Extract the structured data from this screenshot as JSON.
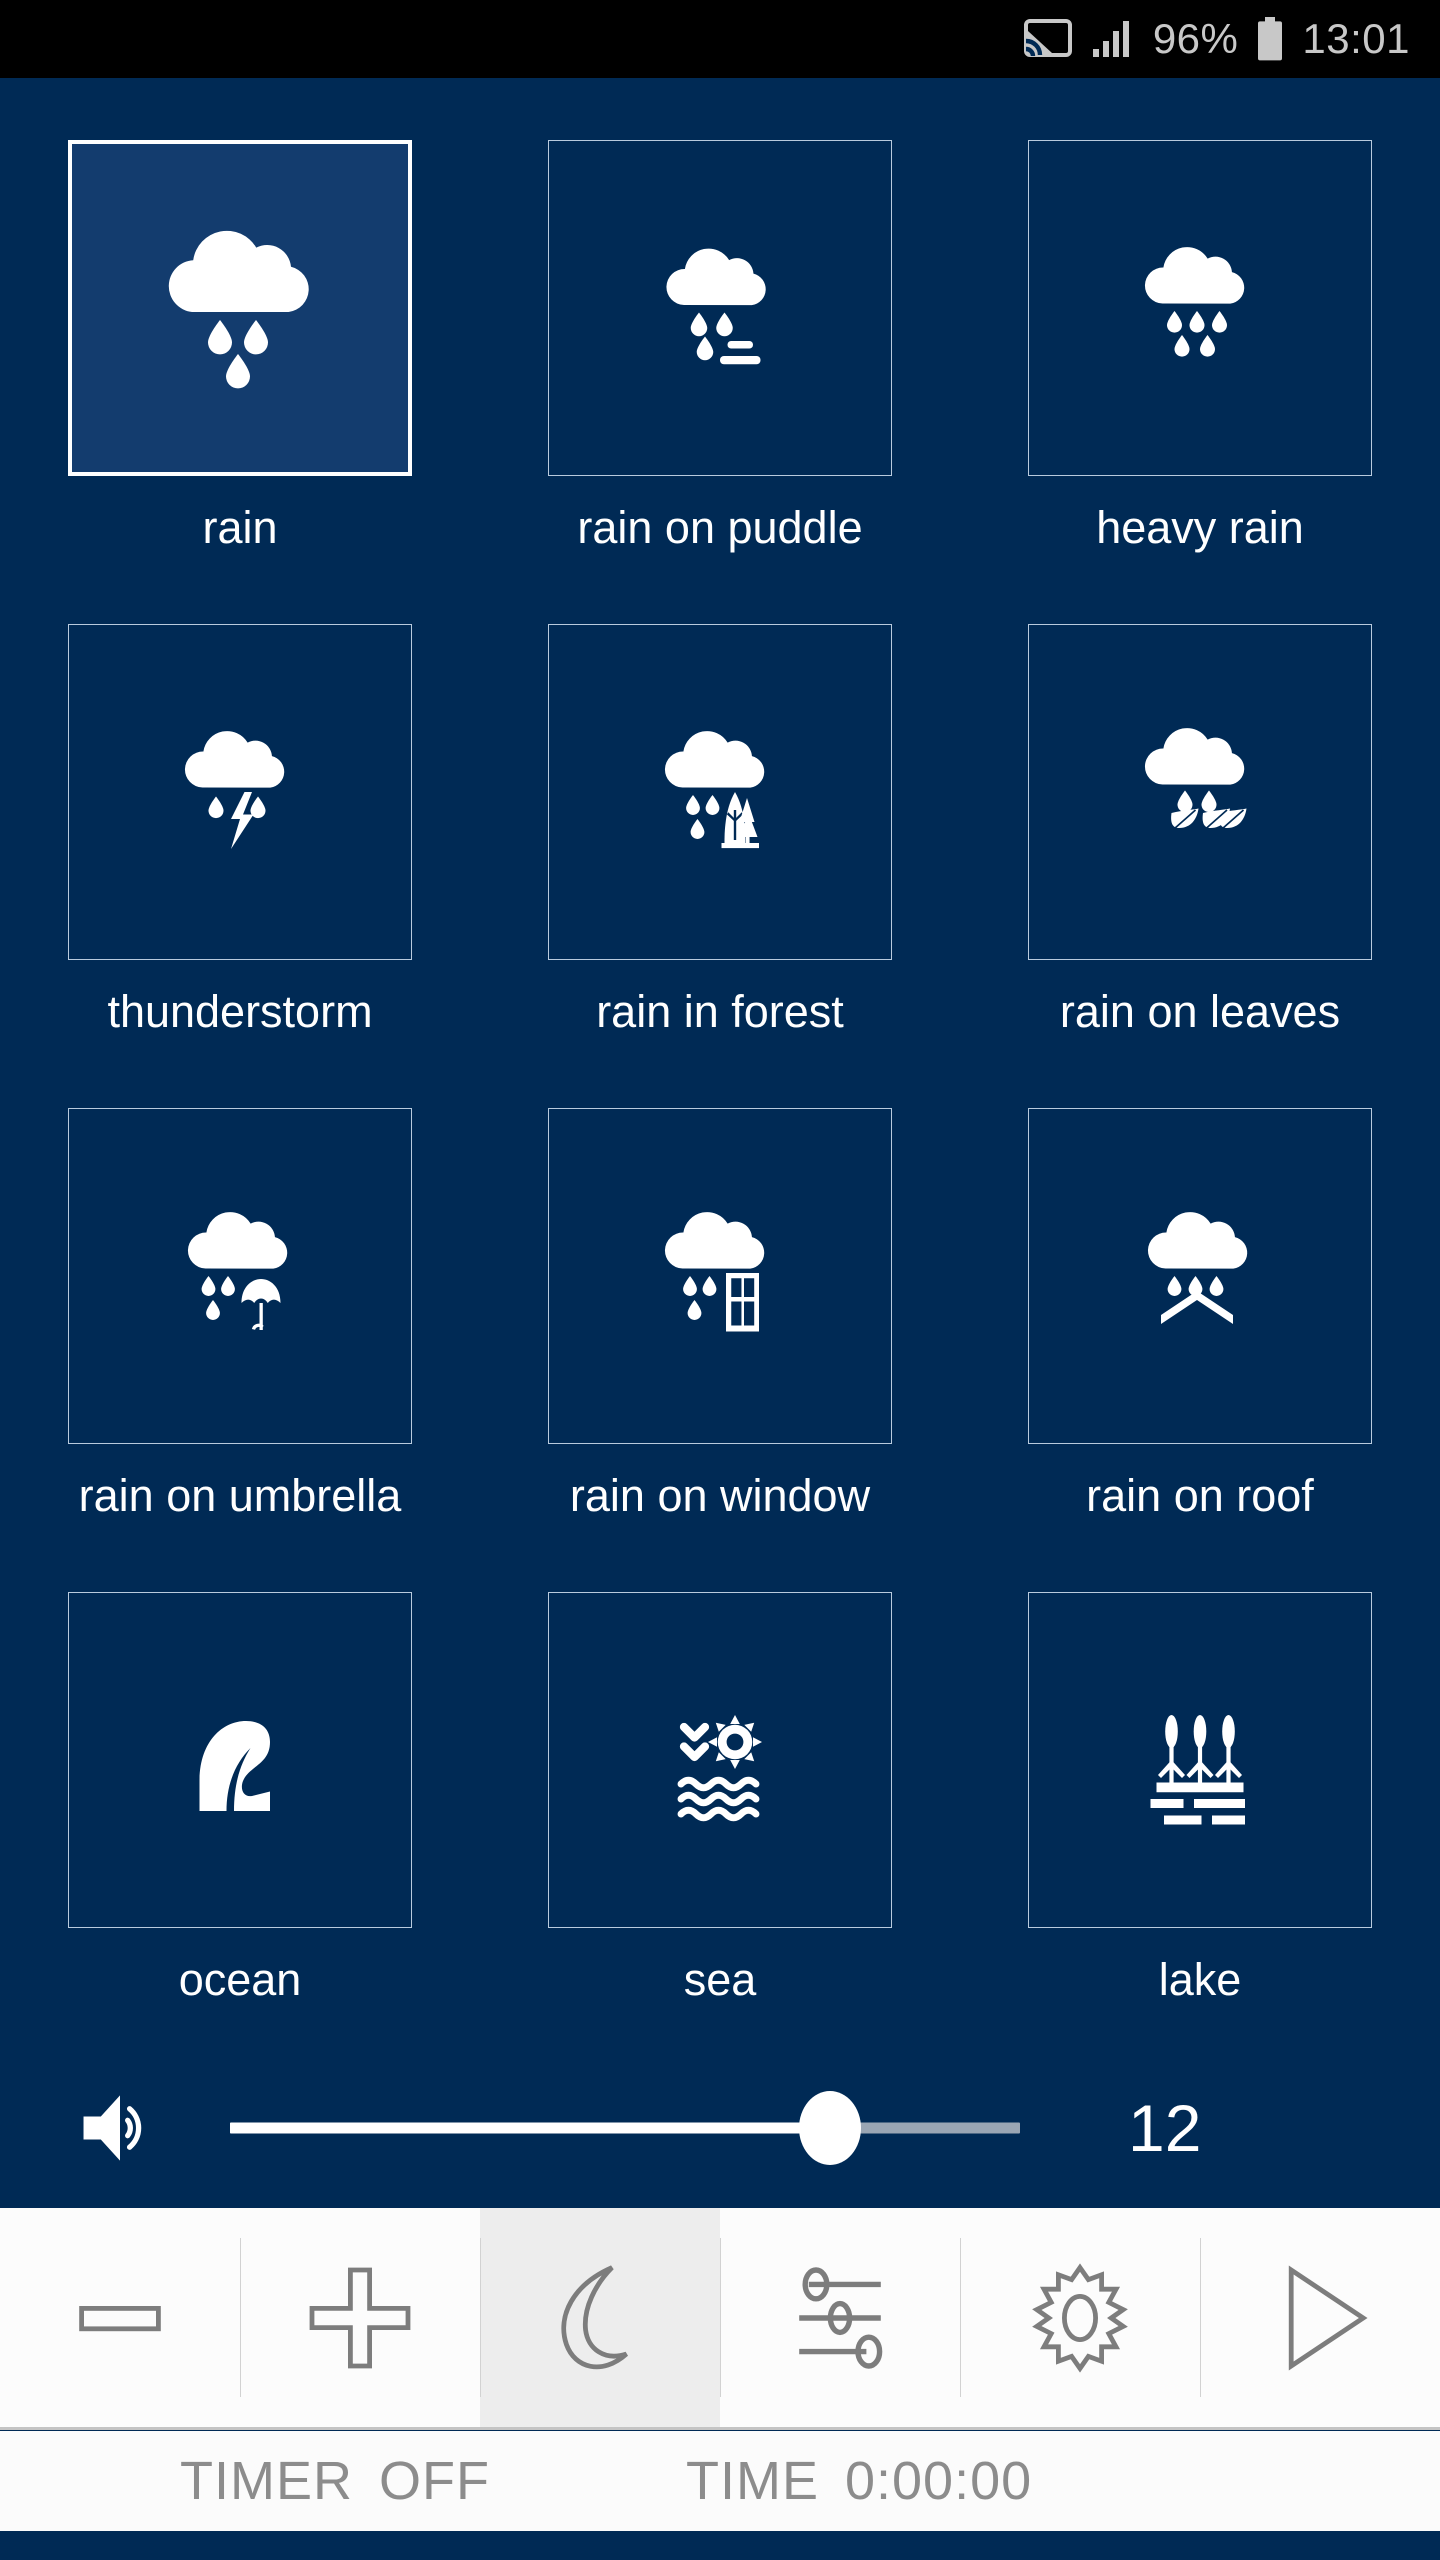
{
  "statusbar": {
    "cast_icon": "cast-icon",
    "signal_icon": "signal-bars-icon",
    "battery_percent": "96%",
    "battery_icon": "battery-icon",
    "clock": "13:01"
  },
  "grid": {
    "rows": [
      [
        {
          "label": "rain",
          "icon": "cloud-rain-icon",
          "selected": true
        },
        {
          "label": "rain on puddle",
          "icon": "cloud-rain-puddle-icon",
          "selected": false
        },
        {
          "label": "heavy rain",
          "icon": "cloud-heavy-rain-icon",
          "selected": false
        }
      ],
      [
        {
          "label": "thunderstorm",
          "icon": "cloud-lightning-icon",
          "selected": false
        },
        {
          "label": "rain in forest",
          "icon": "cloud-rain-tree-icon",
          "selected": false
        },
        {
          "label": "rain on leaves",
          "icon": "cloud-rain-leaves-icon",
          "selected": false
        }
      ],
      [
        {
          "label": "rain on umbrella",
          "icon": "cloud-rain-umbrella-icon",
          "selected": false
        },
        {
          "label": "rain on window",
          "icon": "cloud-rain-window-icon",
          "selected": false
        },
        {
          "label": "rain on roof",
          "icon": "cloud-rain-roof-icon",
          "selected": false
        }
      ],
      [
        {
          "label": "ocean",
          "icon": "ocean-wave-icon",
          "selected": false
        },
        {
          "label": "sea",
          "icon": "sea-sun-waves-icon",
          "selected": false
        },
        {
          "label": "lake",
          "icon": "lake-reeds-icon",
          "selected": false
        }
      ],
      [
        {
          "label": "",
          "icon": "partial-tile",
          "selected": false
        },
        {
          "label": "",
          "icon": "partial-tile",
          "selected": false
        },
        {
          "label": "",
          "icon": "partial-tile",
          "selected": false
        }
      ]
    ]
  },
  "volume": {
    "speaker_icon": "speaker-volume-icon",
    "value": "12",
    "fill_percent": 76
  },
  "toolbar": {
    "buttons": [
      {
        "name": "minus-icon",
        "active": false
      },
      {
        "name": "plus-icon",
        "active": false
      },
      {
        "name": "moon-icon",
        "active": true
      },
      {
        "name": "mixer-icon",
        "active": false
      },
      {
        "name": "gear-icon",
        "active": false
      },
      {
        "name": "play-icon",
        "active": false
      }
    ]
  },
  "bottom_status": {
    "timer_label": "TIMER",
    "timer_value": "OFF",
    "time_label": "TIME",
    "time_value": "0:00:00"
  },
  "colors": {
    "background": "#002A55",
    "tile_selected": "#133C6E",
    "tile_border": "#b9cbde",
    "accent_white": "#ffffff",
    "toolbar_bg": "#fcfcfc",
    "toolbar_icon": "#7d7d7d",
    "status_text": "#8c8c8c"
  }
}
